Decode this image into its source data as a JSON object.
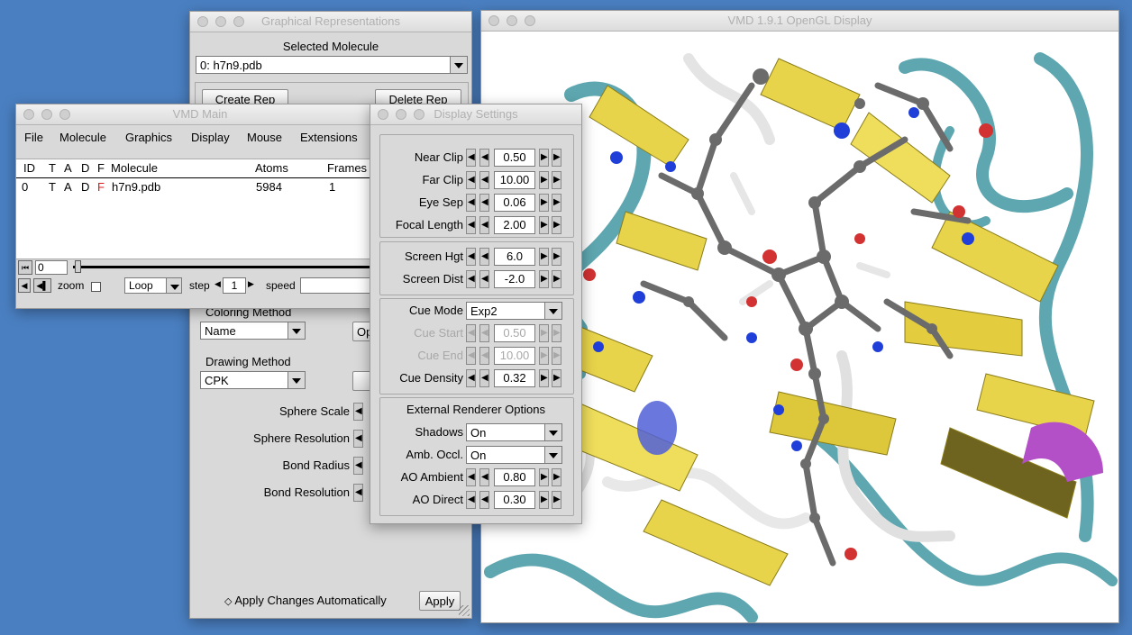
{
  "graph_reps": {
    "title": "Graphical Representations",
    "selected_molecule_label": "Selected Molecule",
    "selected_molecule_value": "0: h7n9.pdb",
    "create_rep": "Create Rep",
    "delete_rep": "Delete Rep",
    "coloring_method_label": "Coloring Method",
    "coloring_method_value": "Name",
    "coloring_extra": "Op",
    "drawing_method_label": "Drawing Method",
    "drawing_method_value": "CPK",
    "sphere_scale": "Sphere Scale",
    "sphere_resolution": "Sphere Resolution",
    "bond_radius": "Bond Radius",
    "bond_resolution": "Bond Resolution",
    "apply_auto": "Apply Changes Automatically",
    "apply": "Apply"
  },
  "vmd_main": {
    "title": "VMD Main",
    "menu": [
      "File",
      "Molecule",
      "Graphics",
      "Display",
      "Mouse",
      "Extensions"
    ],
    "columns": [
      "ID",
      "T",
      "A",
      "D",
      "F",
      "Molecule",
      "Atoms",
      "Frames"
    ],
    "row": {
      "id": "0",
      "t": "T",
      "a": "A",
      "d": "D",
      "f": "F",
      "molecule": "h7n9.pdb",
      "atoms": "5984",
      "frames": "1"
    },
    "frame_value": "0",
    "zoom_label": "zoom",
    "loop_value": "Loop",
    "step_label": "step",
    "step_value": "1",
    "speed_label": "speed"
  },
  "display_settings": {
    "title": "Display Settings",
    "near_clip": {
      "label": "Near Clip",
      "value": "0.50"
    },
    "far_clip": {
      "label": "Far Clip",
      "value": "10.00"
    },
    "eye_sep": {
      "label": "Eye Sep",
      "value": "0.06"
    },
    "focal_length": {
      "label": "Focal Length",
      "value": "2.00"
    },
    "screen_hgt": {
      "label": "Screen Hgt",
      "value": "6.0"
    },
    "screen_dist": {
      "label": "Screen Dist",
      "value": "-2.0"
    },
    "cue_mode": {
      "label": "Cue Mode",
      "value": "Exp2"
    },
    "cue_start": {
      "label": "Cue Start",
      "value": "0.50"
    },
    "cue_end": {
      "label": "Cue End",
      "value": "10.00"
    },
    "cue_density": {
      "label": "Cue Density",
      "value": "0.32"
    },
    "external_header": "External Renderer Options",
    "shadows": {
      "label": "Shadows",
      "value": "On"
    },
    "amb_occl": {
      "label": "Amb. Occl.",
      "value": "On"
    },
    "ao_ambient": {
      "label": "AO Ambient",
      "value": "0.80"
    },
    "ao_direct": {
      "label": "AO Direct",
      "value": "0.30"
    }
  },
  "opengl": {
    "title": "VMD 1.9.1 OpenGL Display"
  },
  "colors": {
    "desktop": "#4a7fc1",
    "ribbon_yellow": "#e8d44a",
    "ribbon_teal": "#5ea7b0",
    "atom_gray": "#6b6b6b",
    "atom_red": "#d23232",
    "atom_blue": "#1f3fd8"
  }
}
